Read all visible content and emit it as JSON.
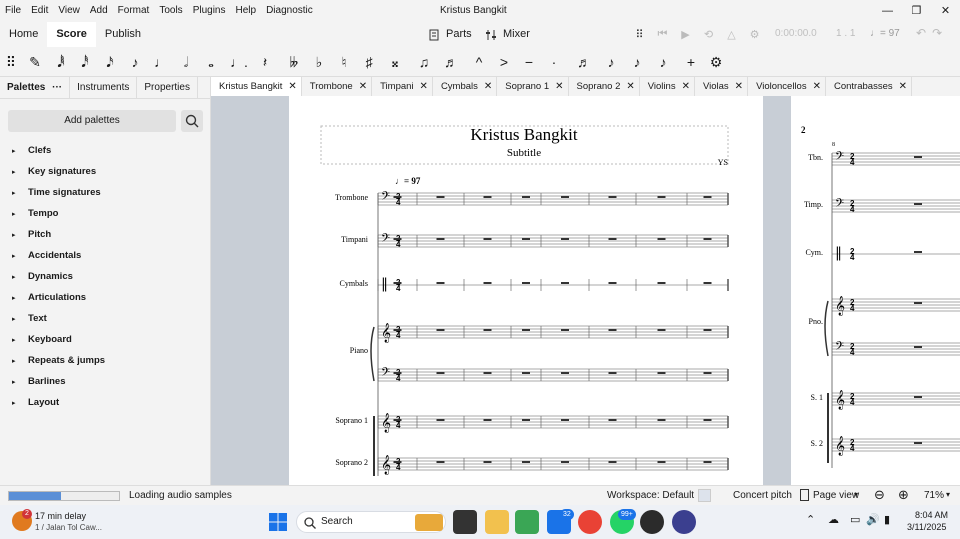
{
  "window": {
    "title": "Kristus Bangkit",
    "minimize": "—",
    "restore": "❐",
    "close": "✕"
  },
  "menu": [
    "File",
    "Edit",
    "View",
    "Add",
    "Format",
    "Tools",
    "Plugins",
    "Help",
    "Diagnostic"
  ],
  "modes": {
    "home": "Home",
    "score": "Score",
    "publish": "Publish"
  },
  "toolbar": {
    "parts": "Parts",
    "mixer": "Mixer",
    "time": "0:00:00.0",
    "measure": "1 . 1",
    "tempo": "♩= 97"
  },
  "palette_tabs": [
    "Palettes",
    "Instruments",
    "Properties"
  ],
  "palette_tab_menu": "···",
  "add_palettes": "Add palettes",
  "palettes": [
    "Clefs",
    "Key signatures",
    "Time signatures",
    "Tempo",
    "Pitch",
    "Accidentals",
    "Dynamics",
    "Articulations",
    "Text",
    "Keyboard",
    "Repeats & jumps",
    "Barlines",
    "Layout"
  ],
  "doc_tabs": [
    "Kristus Bangkit",
    "Trombone",
    "Timpani",
    "Cymbals",
    "Soprano 1",
    "Soprano 2",
    "Violins",
    "Violas",
    "Violoncellos",
    "Contrabasses"
  ],
  "score": {
    "title": "Kristus Bangkit",
    "subtitle": "Subtitle",
    "composer": "YS",
    "tempo_marking": "♩= 97",
    "time_signature": [
      "2",
      "4"
    ],
    "instruments": [
      "Trombone",
      "Timpani",
      "Cymbals",
      "Piano",
      "Soprano 1",
      "Soprano 2"
    ],
    "page2": {
      "page_number": "2",
      "measure_label": "8",
      "instruments": [
        "Tbn.",
        "Timp.",
        "Cym.",
        "Pno.",
        "S. 1",
        "S. 2"
      ]
    }
  },
  "status": {
    "loading": "Loading audio samples",
    "loading_progress": 0.47,
    "workspace": "Workspace: Default",
    "concert_pitch": "Concert pitch",
    "page_view": "Page view",
    "zoom": "71%"
  },
  "taskbar": {
    "notif_count": "2",
    "weather_title": "17 min delay",
    "weather_sub": "1 / Jalan Tol Caw...",
    "search": "Search",
    "store_badge": "32",
    "whatsapp_badge": "99+",
    "time": "8:04 AM",
    "date": "3/11/2025"
  },
  "colors": {
    "accent": "#2f6fd6",
    "canvas": "#c8ced6",
    "selection": "#2f6fd6"
  }
}
